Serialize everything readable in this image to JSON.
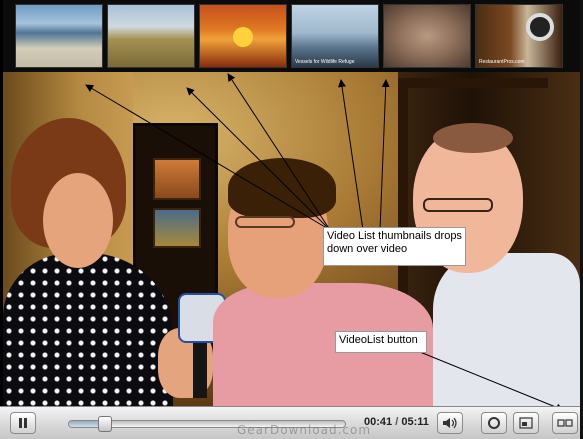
{
  "thumbnails": [
    {
      "name": "beach-thumbnail",
      "caption": ""
    },
    {
      "name": "dunes-thumbnail",
      "caption": ""
    },
    {
      "name": "sunset-thumbnail",
      "caption": ""
    },
    {
      "name": "sailing-thumbnail",
      "caption": "Vessels for Wildlife Refuge"
    },
    {
      "name": "hands-thumbnail",
      "caption": ""
    },
    {
      "name": "restaurant-thumbnail",
      "caption": "RestaurantPros.com"
    }
  ],
  "annotations": {
    "thumbs_callout": "Video List thumbnails drops down over video",
    "button_callout": "VideoList button"
  },
  "controls": {
    "current_time": "00:41",
    "separator": "/",
    "total_time": "05:11",
    "progress": 0.132,
    "watermark": "GearDownload.com"
  },
  "icons": {
    "pause": "pause-icon",
    "volume": "volume-icon",
    "replay": "replay-icon",
    "window": "window-icon",
    "videolist": "videolist-icon"
  },
  "colors": {
    "annotation_arrow": "#000000",
    "control_bar": "#d9d9d9"
  }
}
